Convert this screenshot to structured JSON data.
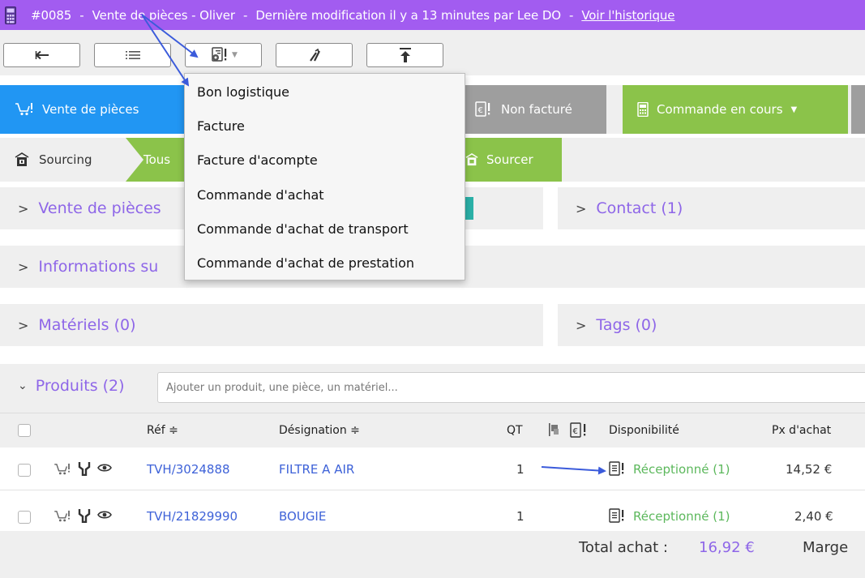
{
  "titlebar": {
    "ref": "#0085",
    "sep1": "-",
    "title": "Vente de pièces - Oliver",
    "sep2": "-",
    "modified": "Dernière modification il y a 13 minutes par Lee DO",
    "sep3": "-",
    "history_link": "Voir l'historique",
    "bg_color": "#a25cf0"
  },
  "toolbar": {
    "buttons": [
      {
        "icon": "back-arrow-icon"
      },
      {
        "icon": "list-icon"
      },
      {
        "icon": "documents-dropdown-icon"
      },
      {
        "icon": "tools-icon"
      },
      {
        "icon": "upload-icon"
      }
    ]
  },
  "status": {
    "vente": {
      "label": "Vente de pièces",
      "color": "#2196f3"
    },
    "facture": {
      "label": "Non facturé",
      "color": "#9e9e9e"
    },
    "commande": {
      "label": "Commande en cours",
      "caret": "▼",
      "color": "#8bc34a"
    }
  },
  "sourcing": {
    "label": "Sourcing",
    "tous": "Tous",
    "sourcer": "Sourcer"
  },
  "panels": {
    "vente": "Vente de pièces",
    "contact": "Contact (1)",
    "informations": "Informations su",
    "materiels": "Matériels (0)",
    "tags": "Tags (0)"
  },
  "produits": {
    "title": "Produits (2)",
    "search_placeholder": "Ajouter un produit, une pièce, un matériel..."
  },
  "table": {
    "headers": {
      "ref": "Réf ≑",
      "designation": "Désignation ≑",
      "qt": "QT",
      "disponibilite": "Disponibilité",
      "px_achat": "Px d'achat"
    },
    "rows": [
      {
        "ref": "TVH/3024888",
        "designation": "FILTRE A AIR",
        "qt": "1",
        "dispo": "Réceptionné (1)",
        "px": "14,52 €"
      },
      {
        "ref": "TVH/21829990",
        "designation": "BOUGIE",
        "qt": "1",
        "dispo": "Réceptionné (1)",
        "px": "2,40 €"
      }
    ]
  },
  "totals": {
    "label": "Total achat :",
    "value": "16,92 €",
    "marge": "Marge"
  },
  "dropdown": {
    "items": [
      "Bon logistique",
      "Facture",
      "Facture d'acompte",
      "Commande d'achat",
      "Commande d'achat de transport",
      "Commande d'achat de prestation"
    ]
  }
}
